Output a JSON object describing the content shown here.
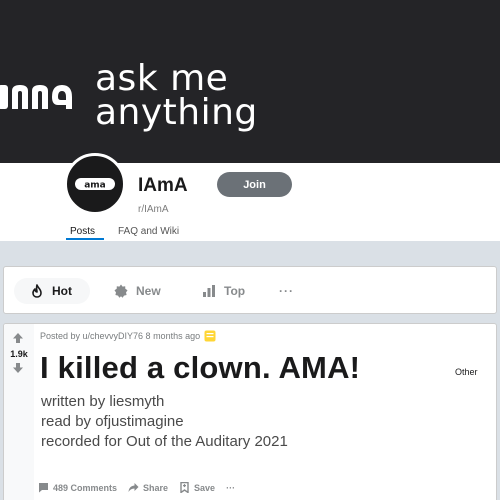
{
  "banner": {
    "fragment_text": "ma",
    "line1": "ask me",
    "line2": "anything"
  },
  "community": {
    "avatar_text": "ama",
    "title": "IAmA",
    "name": "r/IAmA",
    "join_label": "Join",
    "tabs": [
      {
        "label": "Posts",
        "active": true
      },
      {
        "label": "FAQ and Wiki",
        "active": false
      }
    ]
  },
  "sort": {
    "hot": "Hot",
    "new": "New",
    "top": "Top",
    "more": "···"
  },
  "post": {
    "votes": "1.9k",
    "meta": "Posted by u/chevvyDIY76  8 months ago",
    "title": "I killed a clown. AMA!",
    "flair": "Other",
    "body": [
      "written by liesmyth",
      "read by ofjustimagine",
      "recorded for Out of the Auditary 2021"
    ],
    "actions": {
      "comments": "489 Comments",
      "share": "Share",
      "save": "Save",
      "more": "···"
    }
  },
  "colors": {
    "banner_bg": "#242427",
    "accent": "#0079d3",
    "join_bg": "#6b7177",
    "award": "#ffd635"
  }
}
